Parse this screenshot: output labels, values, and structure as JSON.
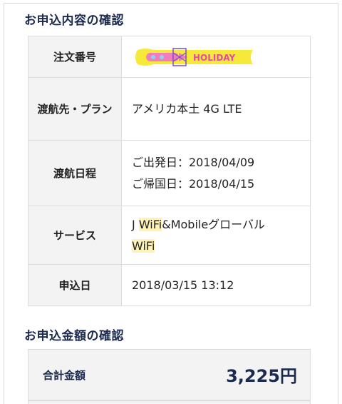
{
  "sections": {
    "order_title": "お申込内容の確認",
    "amount_title": "お申込金額の確認"
  },
  "order": {
    "order_number_label": "注文番号",
    "destination_label": "渡航先・プラン",
    "destination_value": "アメリカ本土 4G LTE",
    "schedule_label": "渡航日程",
    "departure_value": "ご出発日：2018/04/09",
    "return_value": "ご帰国日：2018/04/15",
    "service_label": "サービス",
    "service_prefix": "J ",
    "service_hl1": "WiFi",
    "service_mid": "&Mobileグローバル",
    "service_hl2": "WiFi",
    "apply_date_label": "申込日",
    "apply_date_value": "2018/03/15 13:12"
  },
  "holiday_logo_text": "HOLIDAY",
  "amount": {
    "total_label": "合計金額",
    "total_value": "3,225円"
  },
  "colors": {
    "heading": "#1b2a4e",
    "header_cell_bg": "#f3f3f3",
    "border": "#dcdcdc",
    "highlight": "#fdf2b8",
    "logo_ribbon": "#f7e93a",
    "logo_text": "#e64aa0"
  }
}
